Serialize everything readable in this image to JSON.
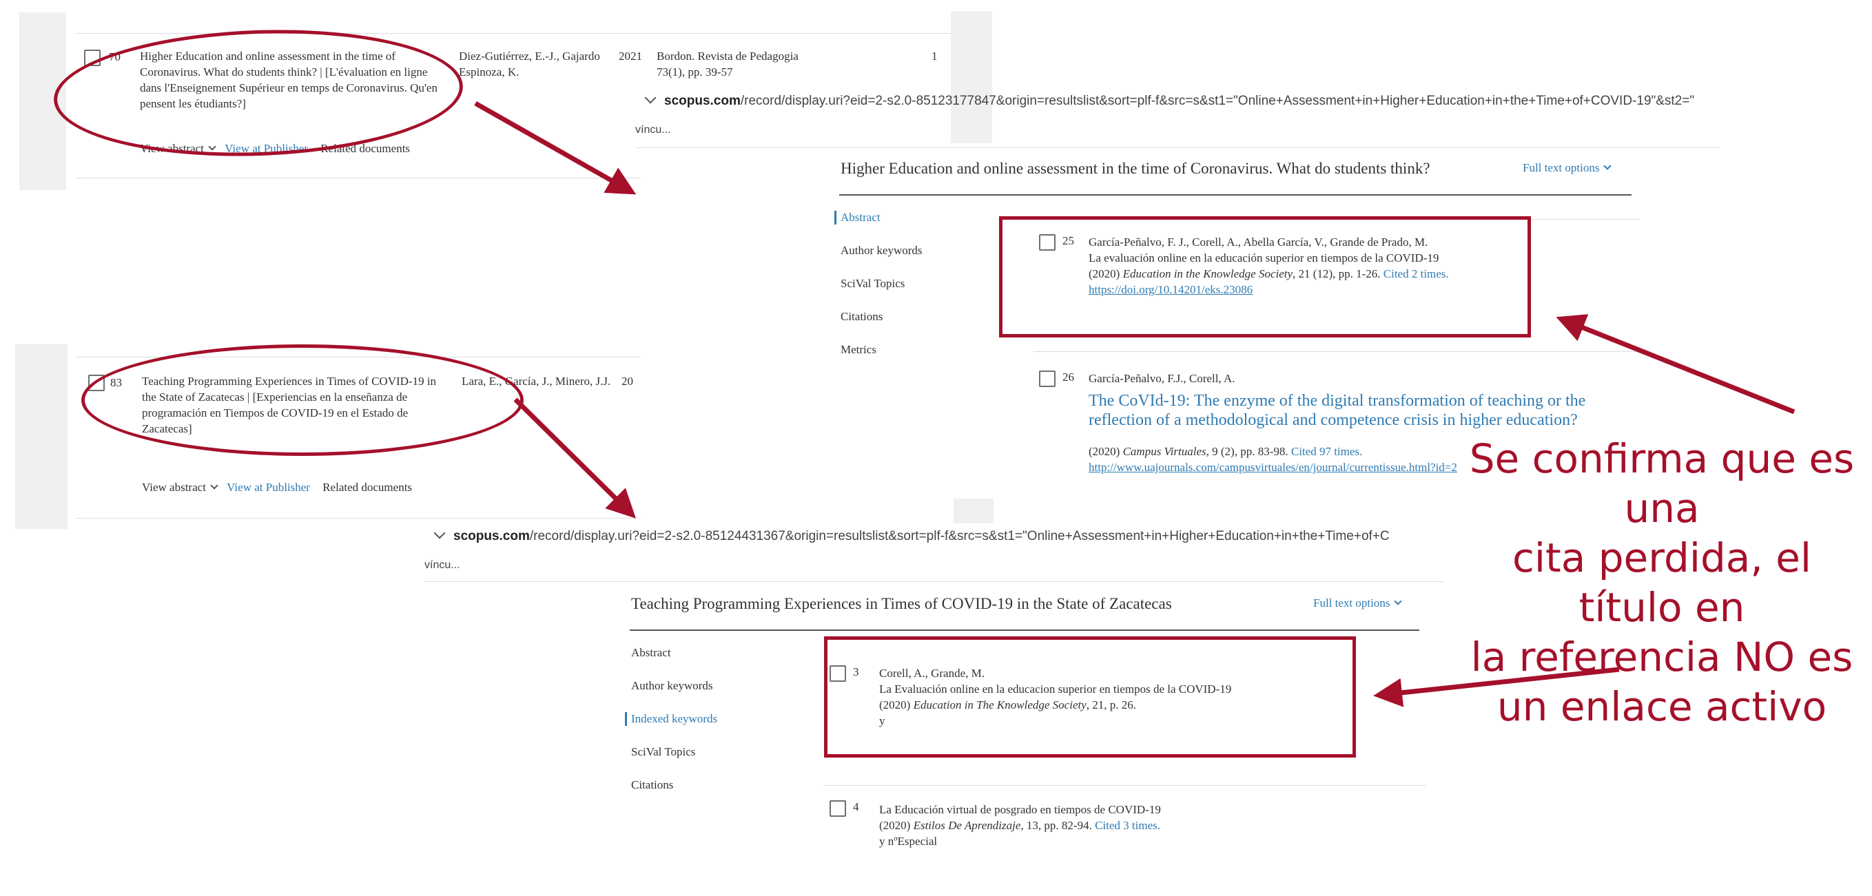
{
  "result_list": {
    "row70": {
      "index": "70",
      "title": "Higher Education and online assessment in the time of Coronavirus. What do students think? | [L'évaluation en ligne dans l'Enseignement Supérieur en temps de Coronavirus. Qu'en pensent les étudiants?]",
      "authors": "Diez-Gutiérrez, E.-J., Gajardo Espinoza, K.",
      "year": "2021",
      "source": "Bordon. Revista de Pedagogia",
      "source_detail": "73(1), pp. 39-57",
      "cited": "1",
      "view_abstract": "View abstract",
      "view_publisher": "View at Publisher",
      "related": "Related documents"
    },
    "row83": {
      "index": "83",
      "title": "Teaching Programming Experiences in Times of COVID-19 in the State of Zacatecas | [Experiencias en la enseñanza de programación en Tiempos de COVID-19 en el Estado de Zacatecas]",
      "authors": "Lara, E., García, J., Minero, J.J.",
      "year": "20",
      "view_abstract": "View abstract",
      "view_publisher": "View at Publisher",
      "related": "Related documents"
    }
  },
  "record1": {
    "url_domain": "scopus.com",
    "url_rest": "/record/display.uri?eid=2-s2.0-85123177847&origin=resultslist&sort=plf-f&src=s&st1=\"Online+Assessment+in+Higher+Education+in+the+Time+of+COVID-19\"&st2=\"",
    "tab_fragment": "víncu...",
    "title": "Higher Education and online assessment in the time of Coronavirus. What do students think?",
    "full_text_options": "Full text options",
    "nav": [
      "Abstract",
      "Author keywords",
      "SciVal Topics",
      "Citations",
      "Metrics"
    ],
    "ref25": {
      "num": "25",
      "authors": "García-Peñalvo, F. J., Corell, A., Abella García, V., Grande de Prado, M.",
      "title": "La evaluación online en la educación superior en tiempos de la COVID-19",
      "year": "(2020)",
      "journal": "Education in the Knowledge Society",
      "detail": ", 21 (12), pp. 1-26.",
      "cited": "Cited 2 times.",
      "doi": "https://doi.org/10.14201/eks.23086"
    },
    "ref26": {
      "num": "26",
      "authors": "García-Peñalvo, F.J., Corell, A.",
      "title": "The CoVId-19: The enzyme of the digital transformation of teaching or the reflection of a methodological and competence crisis in higher education?",
      "year": "(2020)",
      "journal": "Campus Virtuales",
      "detail": ", 9 (2), pp. 83-98.",
      "cited": "Cited 97 times.",
      "url": "http://www.uajournals.com/campusvirtuales/en/journal/currentissue.html?id=2"
    }
  },
  "record2": {
    "url_domain": "scopus.com",
    "url_rest": "/record/display.uri?eid=2-s2.0-85124431367&origin=resultslist&sort=plf-f&src=s&st1=\"Online+Assessment+in+Higher+Education+in+the+Time+of+C",
    "tab_fragment": "víncu...",
    "title": "Teaching Programming Experiences in Times of COVID-19 in the State of Zacatecas",
    "full_text_options": "Full text options",
    "nav": [
      "Abstract",
      "Author keywords",
      "Indexed keywords",
      "SciVal Topics",
      "Citations"
    ],
    "ref3": {
      "num": "3",
      "authors": "Corell, A., Grande, M.",
      "title": "La Evaluación online en la educacion superior en tiempos de la COVID-19",
      "year": "(2020)",
      "journal": "Education in The Knowledge Society",
      "detail": ", 21, p. 26.",
      "extra": "y"
    },
    "ref4": {
      "num": "4",
      "title": "La Educación virtual de posgrado en tiempos de COVID-19",
      "year": "(2020)",
      "journal": "Estilos De Aprendizaje",
      "detail": ", 13, pp. 82-94.",
      "cited": "Cited 3 times.",
      "extra": "y nºEspecial"
    }
  },
  "annotation": {
    "lines": [
      "Se confirma que es una",
      "cita perdida, el título en",
      "la referencia NO es",
      "un enlace activo"
    ],
    "color": "#a5102a"
  },
  "colors": {
    "link": "#2f7bb3",
    "annotation": "#a5102a",
    "panel_bg": "#f0f0f0"
  }
}
